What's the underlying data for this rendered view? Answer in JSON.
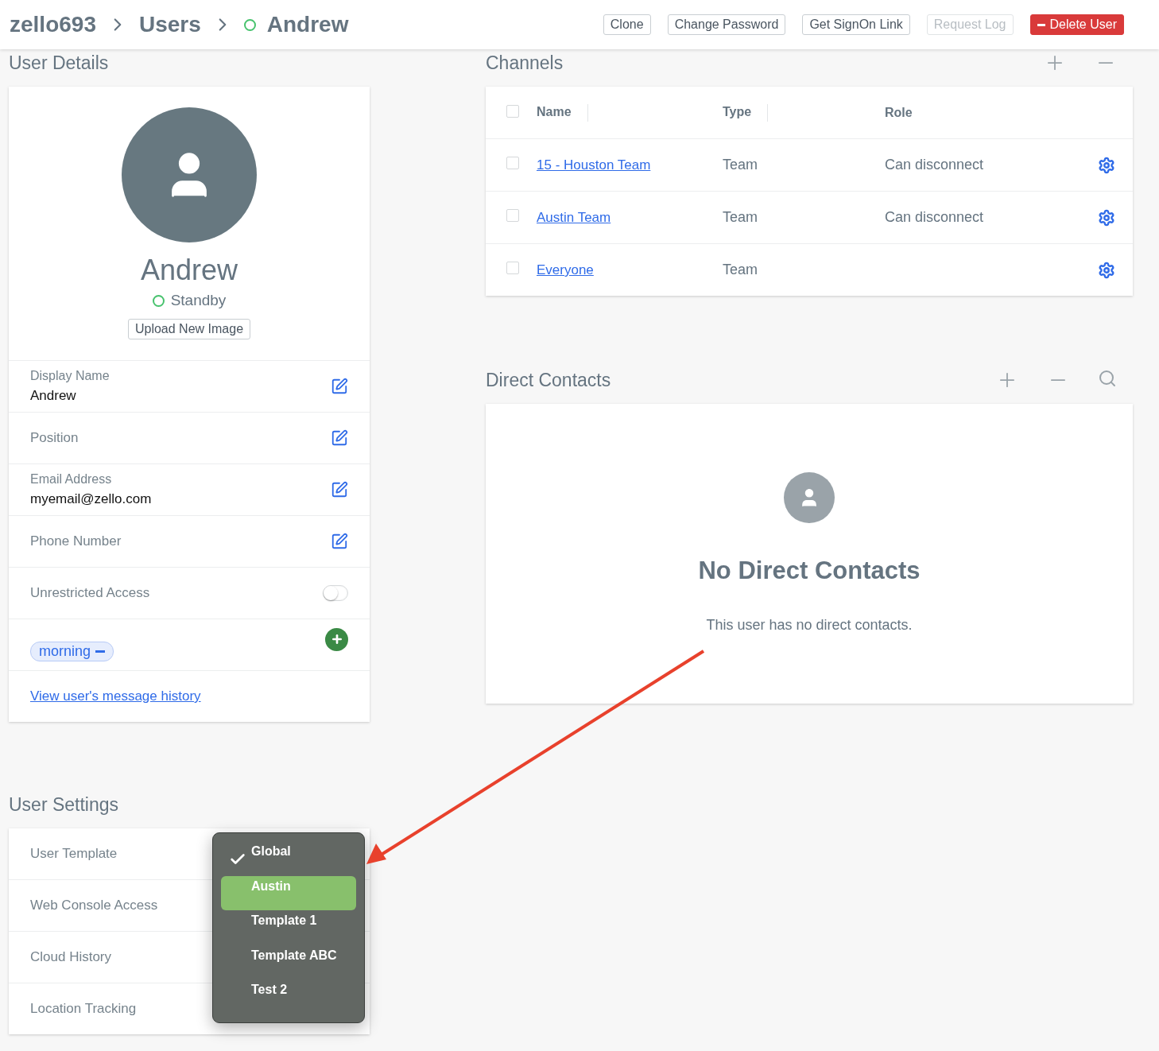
{
  "breadcrumb": [
    {
      "text": "zello693",
      "status_ring": false
    },
    {
      "text": "Users",
      "status_ring": false
    },
    {
      "text": "Andrew",
      "status_ring": true
    }
  ],
  "actions": [
    {
      "label": "Clone",
      "kind": "outline"
    },
    {
      "label": "Change Password",
      "kind": "outline"
    },
    {
      "label": "Get SignOn Link",
      "kind": "outline"
    },
    {
      "label": "Request Log",
      "kind": "disabled"
    },
    {
      "label": "Delete User",
      "kind": "danger"
    }
  ],
  "user_details": {
    "title": "User Details",
    "name": "Andrew",
    "status": "Standby",
    "upload_button": "Upload New Image",
    "fields": [
      {
        "kind": "field",
        "label": "Display Name",
        "value": "Andrew"
      },
      {
        "kind": "field",
        "label": "Position"
      },
      {
        "kind": "field",
        "label": "Email Address",
        "value": "myemail@zello.com"
      },
      {
        "kind": "field",
        "label": "Phone Number"
      },
      {
        "kind": "toggle",
        "label": "Unrestricted Access",
        "on": false
      },
      {
        "kind": "tags",
        "tags": [
          "morning"
        ]
      },
      {
        "kind": "link",
        "label": "View user's message history"
      }
    ]
  },
  "channels": {
    "title": "Channels",
    "select_all_checked": false,
    "columns": [
      "Name",
      "Type",
      "Role"
    ],
    "rows": [
      {
        "name": "15 - Houston Team",
        "type": "Team",
        "role": "Can disconnect",
        "checked": false
      },
      {
        "name": "Austin Team",
        "type": "Team",
        "role": "Can disconnect",
        "checked": false
      },
      {
        "name": "Everyone",
        "type": "Team",
        "checked": false
      }
    ]
  },
  "direct_contacts": {
    "title": "Direct Contacts",
    "empty_title": "No Direct Contacts",
    "empty_text": "This user has no direct contacts."
  },
  "user_settings": {
    "title": "User Settings",
    "rows": [
      "User Template",
      "Web Console Access",
      "Cloud History",
      "Location Tracking"
    ],
    "template_menu": [
      {
        "label": "Global",
        "selected": true,
        "highlighted": false
      },
      {
        "label": "Austin",
        "selected": false,
        "highlighted": true
      },
      {
        "label": "Template 1",
        "selected": false,
        "highlighted": false
      },
      {
        "label": "Template ABC",
        "selected": false,
        "highlighted": false
      },
      {
        "label": "Test 2",
        "selected": false,
        "highlighted": false
      }
    ]
  }
}
